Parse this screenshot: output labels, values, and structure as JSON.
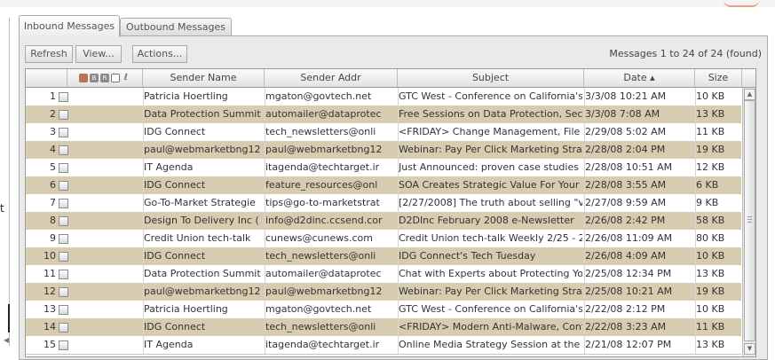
{
  "tabs": [
    {
      "label": "Inbound Messages",
      "active": true
    },
    {
      "label": "Outbound Messages",
      "active": false
    }
  ],
  "toolbar": {
    "refresh": "Refresh",
    "view": "View...",
    "actions": "Actions...",
    "message_count": "Messages 1 to 24 of 24 (found)"
  },
  "columns": {
    "sender_name": "Sender Name",
    "sender_addr": "Sender Addr",
    "subject": "Subject",
    "date": "Date ▴",
    "size": "Size"
  },
  "flag_icons": [
    "status-icon",
    "b-icon",
    "r-icon",
    "box-icon",
    "attachment-icon"
  ],
  "row_colors": {
    "odd": "#ffffff",
    "even": "#d8ccb0"
  },
  "messages": [
    {
      "num": "1",
      "name": "Patricia Hoertling",
      "addr": "mgaton@govtech.net",
      "subject": "GTC West - Conference on California's F",
      "date": "3/3/08 10:21 AM",
      "size": "10 KB"
    },
    {
      "num": "2",
      "name": "Data Protection Summit",
      "addr": "automailer@dataprotec",
      "subject": "Free Sessions on Data Protection, Secu",
      "date": "3/3/08 7:08 AM",
      "size": "13 KB"
    },
    {
      "num": "3",
      "name": "IDG Connect",
      "addr": "tech_newsletters@onli",
      "subject": "<FRIDAY> Change Management, File Ir",
      "date": "2/29/08 5:02 AM",
      "size": "11 KB"
    },
    {
      "num": "4",
      "name": "paul@webmarketbng12",
      "addr": "paul@webmarketbng12",
      "subject": "Webinar: Pay Per Click Marketing Strate",
      "date": "2/28/08 2:04 PM",
      "size": "19 KB"
    },
    {
      "num": "5",
      "name": "IT Agenda",
      "addr": "itagenda@techtarget.ir",
      "subject": "Just Announced: proven case studies re",
      "date": "2/28/08 10:51 AM",
      "size": "12 KB"
    },
    {
      "num": "6",
      "name": "IDG Connect",
      "addr": "feature_resources@onl",
      "subject": "SOA Creates Strategic Value For Your Bu",
      "date": "2/28/08 3:55 AM",
      "size": "6 KB"
    },
    {
      "num": "7",
      "name": "Go-To-Market Strategie",
      "addr": "tips@go-to-marketstrat",
      "subject": "[2/27/2008] The truth about selling \"va",
      "date": "2/27/08 9:59 AM",
      "size": "9 KB"
    },
    {
      "num": "8",
      "name": "Design To Delivery Inc (",
      "addr": "info@d2dinc.ccsend.cor",
      "subject": "D2DInc February 2008 e-Newsletter",
      "date": "2/26/08 2:42 PM",
      "size": "58 KB"
    },
    {
      "num": "9",
      "name": "Credit Union tech-talk",
      "addr": "cunews@cunews.com",
      "subject": "Credit Union tech-talk Weekly 2/25 - 2/2",
      "date": "2/26/08 11:09 AM",
      "size": "80 KB"
    },
    {
      "num": "10",
      "name": "IDG Connect",
      "addr": "tech_newsletters@onli",
      "subject": "IDG Connect's Tech Tuesday",
      "date": "2/26/08 4:09 AM",
      "size": "10 KB"
    },
    {
      "num": "11",
      "name": "Data Protection Summit",
      "addr": "automailer@dataprotec",
      "subject": "Chat with Experts about Protecting You",
      "date": "2/25/08 12:34 PM",
      "size": "13 KB"
    },
    {
      "num": "12",
      "name": "paul@webmarketbng12",
      "addr": "paul@webmarketbng12",
      "subject": "Webinar: Pay Per Click Marketing Strate",
      "date": "2/25/08 10:21 AM",
      "size": "19 KB"
    },
    {
      "num": "13",
      "name": "Patricia Hoertling",
      "addr": "mgaton@govtech.net",
      "subject": "GTC West - Conference on California's F",
      "date": "2/22/08 2:12 PM",
      "size": "10 KB"
    },
    {
      "num": "14",
      "name": "IDG Connect",
      "addr": "tech_newsletters@onli",
      "subject": "<FRIDAY> Modern Anti-Malware, Config",
      "date": "2/22/08 3:23 AM",
      "size": "11 KB"
    },
    {
      "num": "15",
      "name": "IT Agenda",
      "addr": "itagenda@techtarget.ir",
      "subject": "Online Media Strategy Session at the O",
      "date": "2/21/08 12:07 PM",
      "size": "13 KB"
    }
  ]
}
